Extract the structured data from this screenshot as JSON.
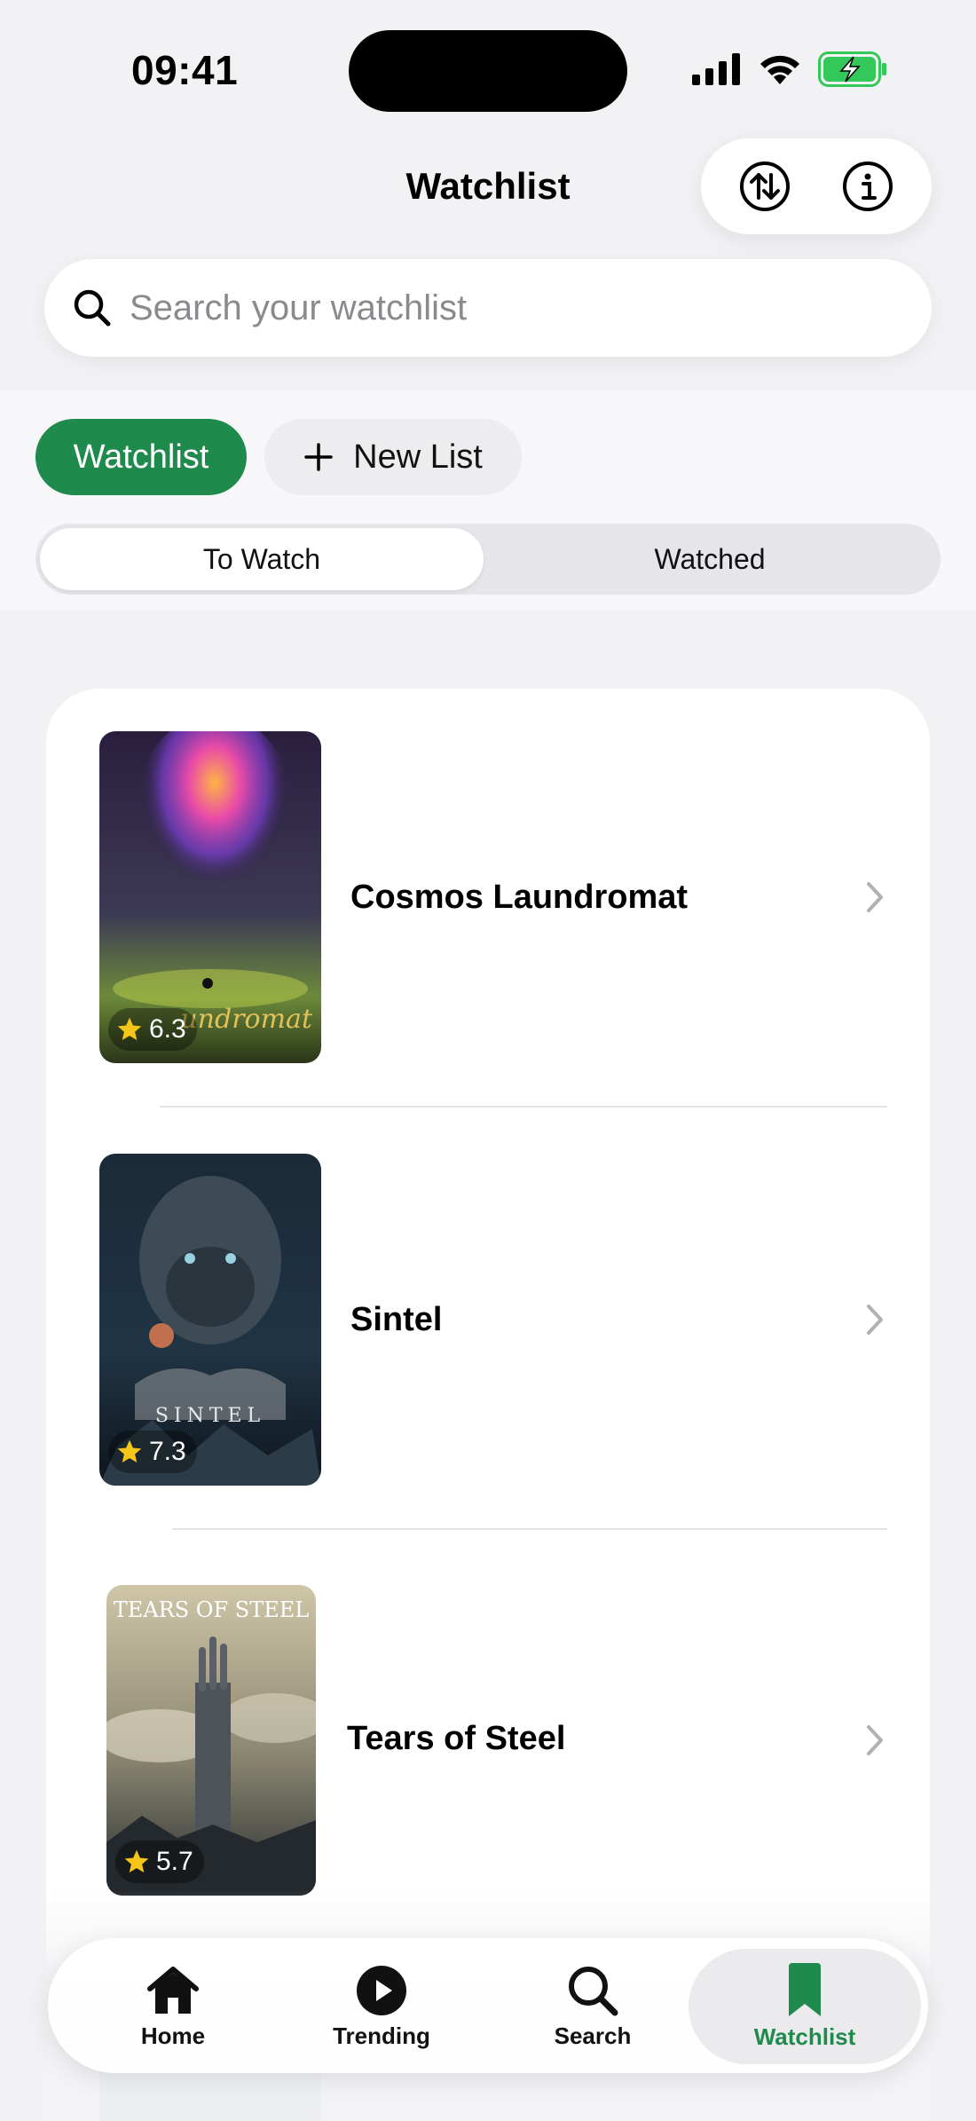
{
  "status_bar": {
    "time": "09:41"
  },
  "header": {
    "title": "Watchlist"
  },
  "search": {
    "placeholder": "Search your watchlist"
  },
  "lists": {
    "active": "Watchlist",
    "new_list": "New List"
  },
  "segments": {
    "to_watch": "To Watch",
    "watched": "Watched",
    "selected": "To Watch"
  },
  "items": [
    {
      "title": "Cosmos Laundromat",
      "rating": "6.3"
    },
    {
      "title": "Sintel",
      "rating": "7.3"
    },
    {
      "title": "Tears of Steel",
      "rating": "5.7"
    }
  ],
  "tabs": [
    {
      "label": "Home"
    },
    {
      "label": "Trending"
    },
    {
      "label": "Search"
    },
    {
      "label": "Watchlist"
    }
  ],
  "colors": {
    "accent": "#1e8a4c",
    "background": "#f2f2f5",
    "star": "#f5c518"
  }
}
